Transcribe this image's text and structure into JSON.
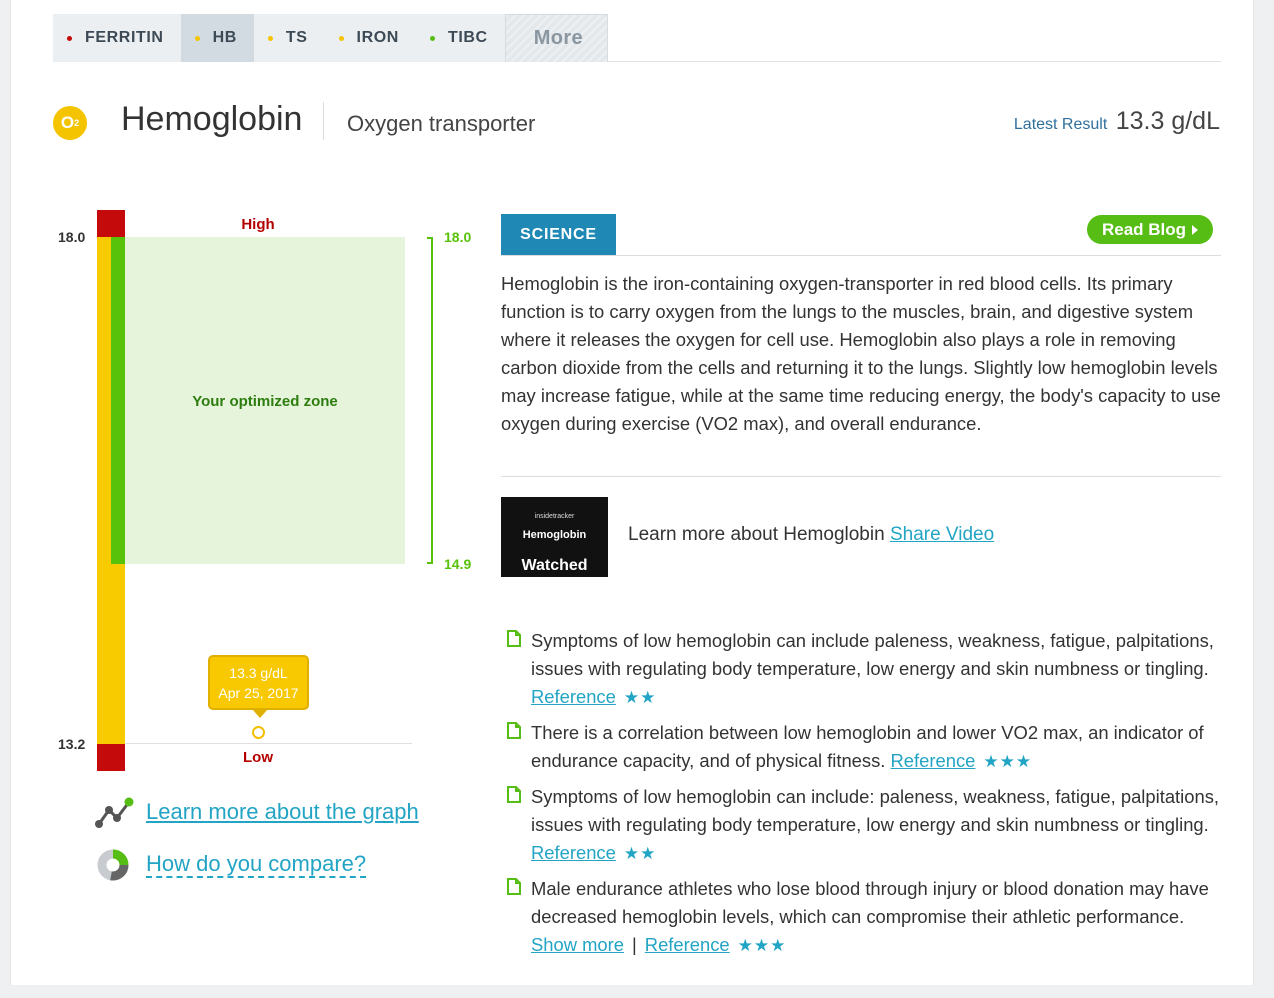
{
  "tabs": [
    {
      "label": "FERRITIN",
      "dot": "#c40a0a",
      "active": false
    },
    {
      "label": "HB",
      "dot": "#f5c400",
      "active": true
    },
    {
      "label": "TS",
      "dot": "#f5c400",
      "active": false
    },
    {
      "label": "IRON",
      "dot": "#f5c400",
      "active": false
    },
    {
      "label": "TIBC",
      "dot": "#55bd14",
      "active": false
    }
  ],
  "more_label": "More",
  "header": {
    "badge": "O",
    "badge_sub": "2",
    "title": "Hemoglobin",
    "subtitle": "Oxygen transporter",
    "latest_label": "Latest Result",
    "latest_value": "13.3 g/dL"
  },
  "graph": {
    "top_value": "18.0",
    "bottom_value": "13.2",
    "high_label": "High",
    "low_label": "Low",
    "zone_label": "Your optimized zone",
    "zone_top": "18.0",
    "zone_bottom": "14.9",
    "tip_value": "13.3 g/dL",
    "tip_date": "Apr 25, 2017",
    "learn_link": "Learn more about the graph",
    "compare_link": "How do you compare?"
  },
  "science": {
    "tab_label": "SCIENCE",
    "blog_label": "Read Blog",
    "description": "Hemoglobin is the iron-containing oxygen-transporter in red blood cells. Its primary function is to carry oxygen from the lungs to the muscles, brain, and digestive system where it releases the oxygen for cell use. Hemoglobin also plays a role in removing carbon dioxide from the cells and returning it to the lungs. Slightly low hemoglobin levels may increase fatigue, while at the same time reducing energy, the body's capacity to use oxygen during exercise (VO2 max), and overall endurance.",
    "video_brand": "insidetracker",
    "video_title": "Hemoglobin",
    "video_watched": "Watched",
    "video_text": "Learn more about Hemoglobin",
    "video_link": "Share Video"
  },
  "facts": [
    {
      "text": "Symptoms of low hemoglobin can include paleness, weakness, fatigue, palpitations, issues with regulating body temperature, low energy and skin numbness or tingling.",
      "ref": "Reference",
      "stars": "★★"
    },
    {
      "text": "There is a correlation between low hemoglobin and lower VO2 max, an indicator of endurance capacity, and of physical fitness.",
      "ref": "Reference",
      "stars": "★★★"
    },
    {
      "text": "Symptoms of low hemoglobin can include: paleness, weakness, fatigue, palpitations, issues with regulating body temperature, low energy and skin numbness or tingling.",
      "ref": "Reference",
      "stars": "★★"
    },
    {
      "text": "Male endurance athletes who lose blood through injury or blood donation may have decreased hemoglobin levels, which can compromise their athletic performance.",
      "show_more": "Show more",
      "separator": "|",
      "ref": "Reference",
      "stars": "★★★"
    }
  ]
}
